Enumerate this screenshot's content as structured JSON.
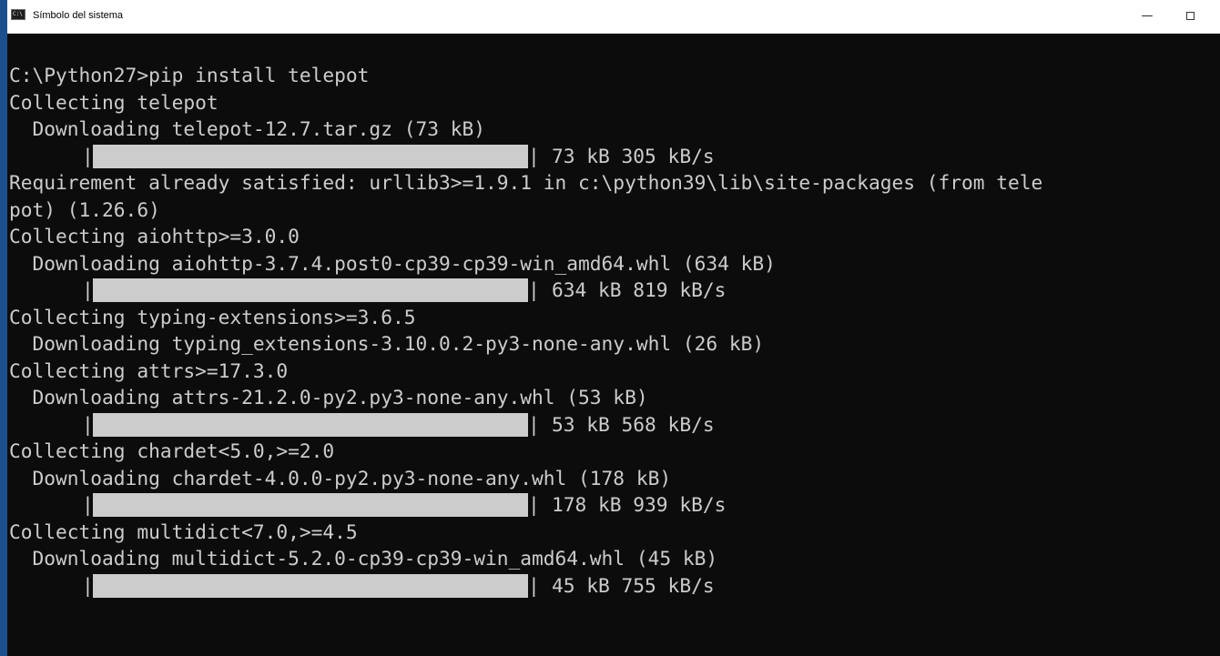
{
  "window": {
    "title": "Símbolo del sistema",
    "icon_name": "console-icon",
    "icon_text": "C:\\",
    "controls": {
      "minimize_label": "—"
    }
  },
  "console_lines": [
    {
      "type": "text",
      "text": "C:\\Python27>pip install telepot"
    },
    {
      "type": "text",
      "text": "Collecting telepot"
    },
    {
      "type": "text",
      "text": "  Downloading telepot-12.7.tar.gz (73 kB)"
    },
    {
      "type": "progress",
      "pipe": "|",
      "progress": 1.0,
      "stats": "73 kB 305 kB/s"
    },
    {
      "type": "text",
      "text": "Requirement already satisfied: urllib3>=1.9.1 in c:\\python39\\lib\\site-packages (from tele"
    },
    {
      "type": "text",
      "text": "pot) (1.26.6)"
    },
    {
      "type": "text",
      "text": "Collecting aiohttp>=3.0.0"
    },
    {
      "type": "text",
      "text": "  Downloading aiohttp-3.7.4.post0-cp39-cp39-win_amd64.whl (634 kB)"
    },
    {
      "type": "progress",
      "pipe": "|",
      "progress": 1.0,
      "stats": "634 kB 819 kB/s"
    },
    {
      "type": "text",
      "text": "Collecting typing-extensions>=3.6.5"
    },
    {
      "type": "text",
      "text": "  Downloading typing_extensions-3.10.0.2-py3-none-any.whl (26 kB)"
    },
    {
      "type": "text",
      "text": "Collecting attrs>=17.3.0"
    },
    {
      "type": "text",
      "text": "  Downloading attrs-21.2.0-py2.py3-none-any.whl (53 kB)"
    },
    {
      "type": "progress",
      "pipe": "|",
      "progress": 1.0,
      "stats": "53 kB 568 kB/s"
    },
    {
      "type": "text",
      "text": "Collecting chardet<5.0,>=2.0"
    },
    {
      "type": "text",
      "text": "  Downloading chardet-4.0.0-py2.py3-none-any.whl (178 kB)"
    },
    {
      "type": "progress",
      "pipe": "|",
      "progress": 1.0,
      "stats": "178 kB 939 kB/s"
    },
    {
      "type": "text",
      "text": "Collecting multidict<7.0,>=4.5"
    },
    {
      "type": "text",
      "text": "  Downloading multidict-5.2.0-cp39-cp39-win_amd64.whl (45 kB)"
    },
    {
      "type": "progress",
      "pipe": "|",
      "progress": 1.0,
      "stats": "45 kB 755 kB/s"
    }
  ],
  "colors": {
    "console_background": "#0c0c0c",
    "console_text": "#cccccc",
    "progress_fill": "#cccccc",
    "titlebar_background": "#ffffff",
    "accent": "#1d4f8c"
  }
}
